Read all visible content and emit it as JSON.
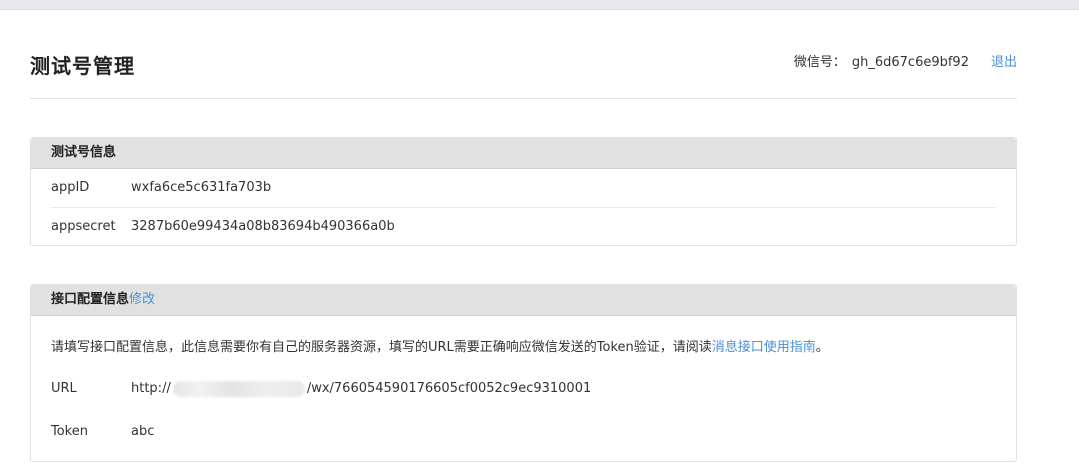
{
  "header": {
    "title": "测试号管理",
    "wx_label": "微信号：",
    "wx_id": "gh_6d67c6e9bf92",
    "logout": "退出"
  },
  "info_panel": {
    "title": "测试号信息",
    "rows": [
      {
        "key": "appID",
        "value": "wxfa6ce5c631fa703b"
      },
      {
        "key": "appsecret",
        "value": "3287b60e99434a08b83694b490366a0b"
      }
    ]
  },
  "config_panel": {
    "title": "接口配置信息",
    "edit": "修改",
    "desc_prefix": "请填写接口配置信息，此信息需要你有自己的服务器资源，填写的URL需要正确响应微信发送的Token验证，请阅读",
    "desc_link": "消息接口使用指南",
    "desc_suffix": "。",
    "url_label": "URL",
    "url_prefix": "http://",
    "url_suffix": "/wx/766054590176605cf0052c9ec9310001",
    "token_label": "Token",
    "token_value": "abc"
  }
}
